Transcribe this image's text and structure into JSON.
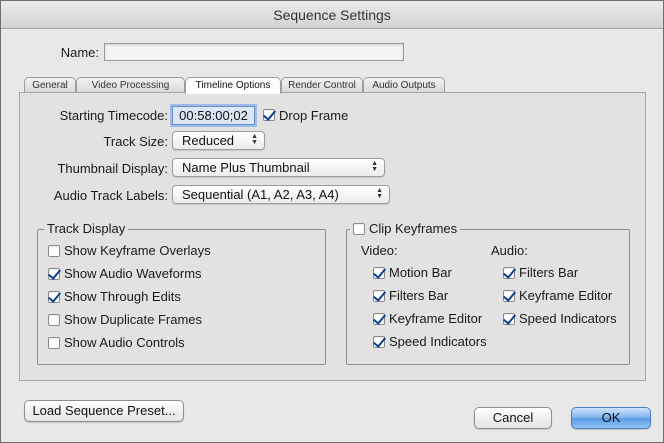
{
  "window": {
    "title": "Sequence Settings"
  },
  "name_field": {
    "label": "Name:",
    "value": ""
  },
  "tabs": [
    {
      "label": "General",
      "active": false
    },
    {
      "label": "Video Processing",
      "active": false
    },
    {
      "label": "Timeline Options",
      "active": true
    },
    {
      "label": "Render Control",
      "active": false
    },
    {
      "label": "Audio Outputs",
      "active": false
    }
  ],
  "timeline": {
    "starting_timecode_label": "Starting Timecode:",
    "starting_timecode_value": "00:58:00;02",
    "drop_frame_label": "Drop Frame",
    "drop_frame_checked": true,
    "track_size_label": "Track Size:",
    "track_size_value": "Reduced",
    "thumbnail_display_label": "Thumbnail Display:",
    "thumbnail_display_value": "Name Plus Thumbnail",
    "audio_track_labels_label": "Audio Track Labels:",
    "audio_track_labels_value": "Sequential (A1, A2, A3, A4)"
  },
  "track_display": {
    "title": "Track Display",
    "items": [
      {
        "label": "Show Keyframe Overlays",
        "checked": false
      },
      {
        "label": "Show Audio Waveforms",
        "checked": true
      },
      {
        "label": "Show Through Edits",
        "checked": true
      },
      {
        "label": "Show Duplicate Frames",
        "checked": false
      },
      {
        "label": "Show Audio Controls",
        "checked": false
      }
    ]
  },
  "clip_keyframes": {
    "title": "Clip Keyframes",
    "checked": false,
    "video_label": "Video:",
    "audio_label": "Audio:",
    "video_items": [
      {
        "label": "Motion Bar",
        "checked": true
      },
      {
        "label": "Filters Bar",
        "checked": true
      },
      {
        "label": "Keyframe Editor",
        "checked": true
      },
      {
        "label": "Speed Indicators",
        "checked": true
      }
    ],
    "audio_items": [
      {
        "label": "Filters Bar",
        "checked": true
      },
      {
        "label": "Keyframe Editor",
        "checked": true
      },
      {
        "label": "Speed Indicators",
        "checked": true
      }
    ]
  },
  "buttons": {
    "load_preset": "Load Sequence Preset...",
    "cancel": "Cancel",
    "ok": "OK"
  }
}
